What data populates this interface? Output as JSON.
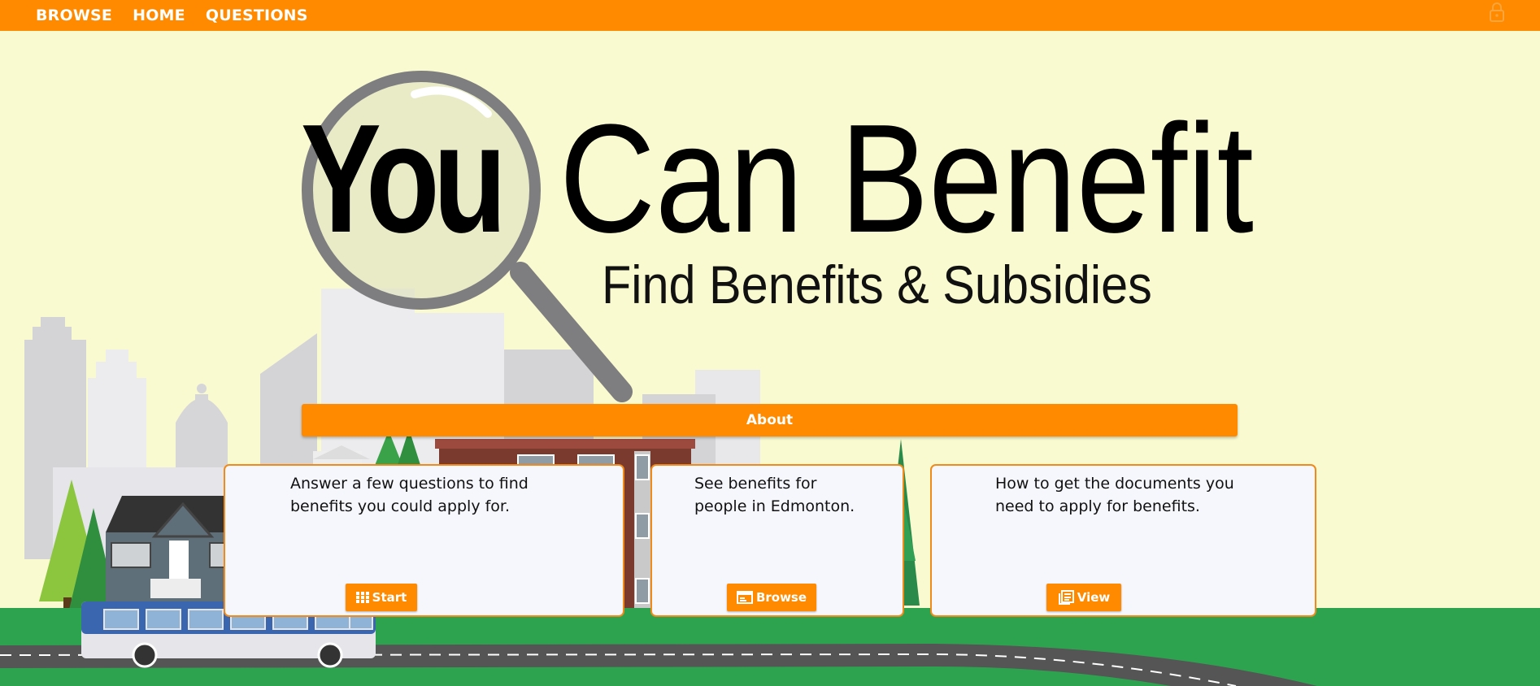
{
  "nav": {
    "items": [
      {
        "label": "BROWSE"
      },
      {
        "label": "HOME"
      },
      {
        "label": "QUESTIONS"
      }
    ]
  },
  "hero": {
    "title_you": "You",
    "title_rest": "Can Benefit",
    "subtitle": "Find Benefits & Subsidies"
  },
  "about": {
    "label": "About"
  },
  "cards": [
    {
      "text_line1": "Answer a few questions to find",
      "text_line2": "benefits you could apply for.",
      "button": "Start",
      "icon": "grid-icon"
    },
    {
      "text_line1": "See benefits for",
      "text_line2": "people in Edmonton.",
      "button": "Browse",
      "icon": "browser-window-icon"
    },
    {
      "text_line1": "How to get the documents you",
      "text_line2": "need to apply for benefits.",
      "button": "View",
      "icon": "documents-icon"
    }
  ],
  "colors": {
    "accent": "#ff8a00",
    "background": "#fafad0",
    "grass": "#2ea34f",
    "road": "#555555"
  }
}
